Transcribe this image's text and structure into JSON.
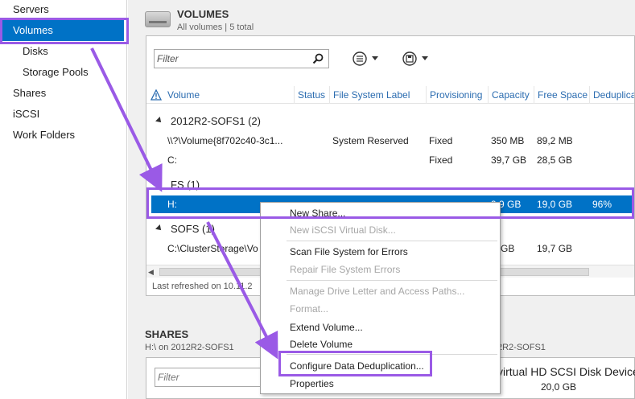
{
  "sidebar": {
    "items": [
      {
        "label": "Servers"
      },
      {
        "label": "Volumes"
      },
      {
        "label": "Disks"
      },
      {
        "label": "Storage Pools"
      },
      {
        "label": "Shares"
      },
      {
        "label": "iSCSI"
      },
      {
        "label": "Work Folders"
      }
    ]
  },
  "volumes": {
    "title": "VOLUMES",
    "subtitle": "All volumes | 5 total",
    "filter_placeholder": "Filter",
    "columns": [
      "Volume",
      "Status",
      "File System Label",
      "Provisioning",
      "Capacity",
      "Free Space",
      "Deduplica"
    ],
    "groups": [
      {
        "label": "2012R2-SOFS1 (2)"
      },
      {
        "label": "FS (1)"
      },
      {
        "label": "SOFS (1)"
      }
    ],
    "rows": [
      {
        "volume": "\\\\?\\Volume{8f702c40-3c1...",
        "label": "System Reserved",
        "provisioning": "Fixed",
        "capacity": "350 MB",
        "free": "89,2 MB",
        "dedup": ""
      },
      {
        "volume": "C:",
        "label": "",
        "provisioning": "Fixed",
        "capacity": "39,7 GB",
        "free": "28,5 GB",
        "dedup": ""
      },
      {
        "volume": "H:",
        "label": "",
        "provisioning": "",
        "capacity": "9,9 GB",
        "free": "19,0 GB",
        "dedup": "96%"
      },
      {
        "volume": "C:\\ClusterStorage\\Vo",
        "label": "",
        "provisioning": "",
        "capacity": "9 GB",
        "free": "19,7 GB",
        "dedup": ""
      }
    ],
    "status": "Last refreshed on 10.11.2"
  },
  "shares": {
    "title": "SHARES",
    "subtitle": "H:\\ on 2012R2-SOFS1",
    "filter_placeholder": "Filter"
  },
  "disk": {
    "subtitle": "2R2-SOFS1",
    "name": "virtual HD SCSI Disk Device",
    "size": "20,0 GB"
  },
  "context_menu": {
    "items": [
      {
        "label": "New Share...",
        "enabled": true
      },
      {
        "label": "New iSCSI Virtual Disk...",
        "enabled": false
      },
      {
        "label": "Scan File System for Errors",
        "enabled": true
      },
      {
        "label": "Repair File System Errors",
        "enabled": false
      },
      {
        "label": "Manage Drive Letter and Access Paths...",
        "enabled": false
      },
      {
        "label": "Format...",
        "enabled": false
      },
      {
        "label": "Extend Volume...",
        "enabled": true
      },
      {
        "label": "Delete Volume",
        "enabled": true
      },
      {
        "label": "Configure Data Deduplication...",
        "enabled": true
      },
      {
        "label": "Properties",
        "enabled": true
      }
    ]
  },
  "colors": {
    "selection": "#0072c6",
    "annotation": "#9a5ae6",
    "header_link": "#2b6cb0",
    "disabled_text": "#a6a6a6"
  }
}
